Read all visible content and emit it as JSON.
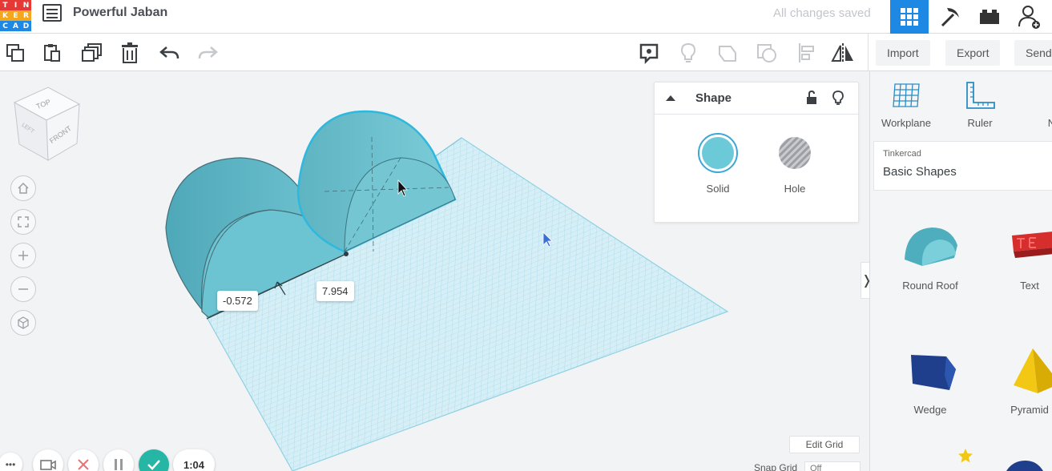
{
  "header": {
    "logo_letters": [
      "T",
      "I",
      "N",
      "K",
      "E",
      "R",
      "C",
      "A",
      "D"
    ],
    "logo_colors": [
      "#e53935",
      "#e53935",
      "#e53935",
      "#f4a61c",
      "#f4a61c",
      "#f4a61c",
      "#1e88e5",
      "#1e88e5",
      "#1e88e5"
    ],
    "project_title": "Powerful Jaban",
    "save_status": "All changes saved",
    "icons": [
      "grid-view-icon",
      "pickaxe-icon",
      "brick-icon",
      "user-add-icon"
    ]
  },
  "toolbar": {
    "left_icons": [
      "copy-icon",
      "paste-icon",
      "duplicate-icon",
      "delete-icon",
      "undo-icon",
      "redo-icon"
    ],
    "right_icons": [
      "note-icon",
      "lightbulb-icon",
      "group-icon",
      "ungroup-icon",
      "align-icon",
      "mirror-icon"
    ],
    "import_label": "Import",
    "export_label": "Export",
    "send_label": "Send"
  },
  "viewcube": {
    "top": "TOP",
    "front": "FRONT",
    "left": "LEFT"
  },
  "view_controls": [
    "home-icon",
    "fit-icon",
    "zoom-in-icon",
    "zoom-out-icon",
    "perspective-icon"
  ],
  "dimensions": {
    "offset": "-0.572",
    "length": "7.954"
  },
  "inspector": {
    "title": "Shape",
    "solid_label": "Solid",
    "hole_label": "Hole",
    "solid_color": "#6cc9d8"
  },
  "grid_controls": {
    "edit_grid_label": "Edit Grid",
    "snap_grid_label": "Snap Grid",
    "snap_value": "Off"
  },
  "timer": "1:04",
  "right_panel": {
    "tools": [
      {
        "label": "Workplane",
        "icon": "workplane-icon"
      },
      {
        "label": "Ruler",
        "icon": "ruler-icon"
      },
      {
        "label": "No",
        "icon": "notes-icon"
      }
    ],
    "library_source": "Tinkercad",
    "library_name": "Basic Shapes",
    "shapes": [
      {
        "label": "Round Roof",
        "color": "#5bbcca"
      },
      {
        "label": "Text",
        "color": "#d62d2d"
      },
      {
        "label": "Wedge",
        "color": "#1f3f8c"
      },
      {
        "label": "Pyramid",
        "color": "#f2c814"
      }
    ]
  },
  "colors": {
    "accent": "#1e88e5",
    "shape": "#6cc9d8",
    "grid": "#a8dceb"
  }
}
